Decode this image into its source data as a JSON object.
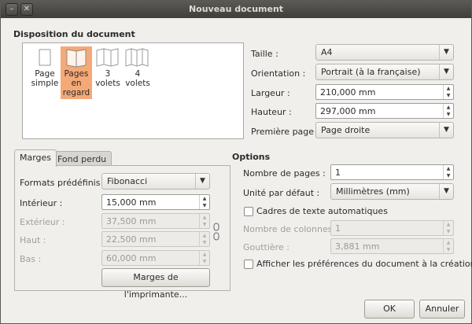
{
  "window": {
    "title": "Nouveau document",
    "minimize_glyph": "–",
    "close_glyph": "✕"
  },
  "layout": {
    "heading": "Disposition du document",
    "items": [
      {
        "label_line1": "Page",
        "label_line2": "simple",
        "label_line3": ""
      },
      {
        "label_line1": "Pages",
        "label_line2": "en",
        "label_line3": "regard"
      },
      {
        "label_line1": "3",
        "label_line2": "volets",
        "label_line3": ""
      },
      {
        "label_line1": "4",
        "label_line2": "volets",
        "label_line3": ""
      }
    ],
    "selected_index": 1,
    "selected_color": "#f5a977"
  },
  "page_settings": {
    "size_label": "Taille :",
    "size_value": "A4",
    "orientation_label": "Orientation :",
    "orientation_value": "Portrait (à la française)",
    "width_label": "Largeur :",
    "width_value": "210,000 mm",
    "height_label": "Hauteur :",
    "height_value": "297,000 mm",
    "first_page_label": "Première page :",
    "first_page_value": "Page droite"
  },
  "tabs": {
    "margins": "Marges",
    "bleed": "Fond perdu"
  },
  "margins": {
    "preset_label": "Formats prédéfinis :",
    "preset_value": "Fibonacci",
    "inner_label": "Intérieur :",
    "inner_value": "15,000 mm",
    "outer_label": "Extérieur :",
    "outer_value": "37,500 mm",
    "top_label": "Haut :",
    "top_value": "22,500 mm",
    "bottom_label": "Bas :",
    "bottom_value": "60,000 mm",
    "printer_margins_button": "Marges de l'imprimante..."
  },
  "options": {
    "heading": "Options",
    "pages_label": "Nombre de pages :",
    "pages_value": "1",
    "unit_label": "Unité par défaut :",
    "unit_value": "Millimètres (mm)",
    "auto_frames_label": "Cadres de texte automatiques",
    "columns_label": "Nombre de colonnes :",
    "columns_value": "1",
    "gutter_label": "Gouttière :",
    "gutter_value": "3,881 mm",
    "show_prefs_label": "Afficher les préférences du document à la création"
  },
  "footer": {
    "ok": "OK",
    "cancel": "Annuler"
  }
}
